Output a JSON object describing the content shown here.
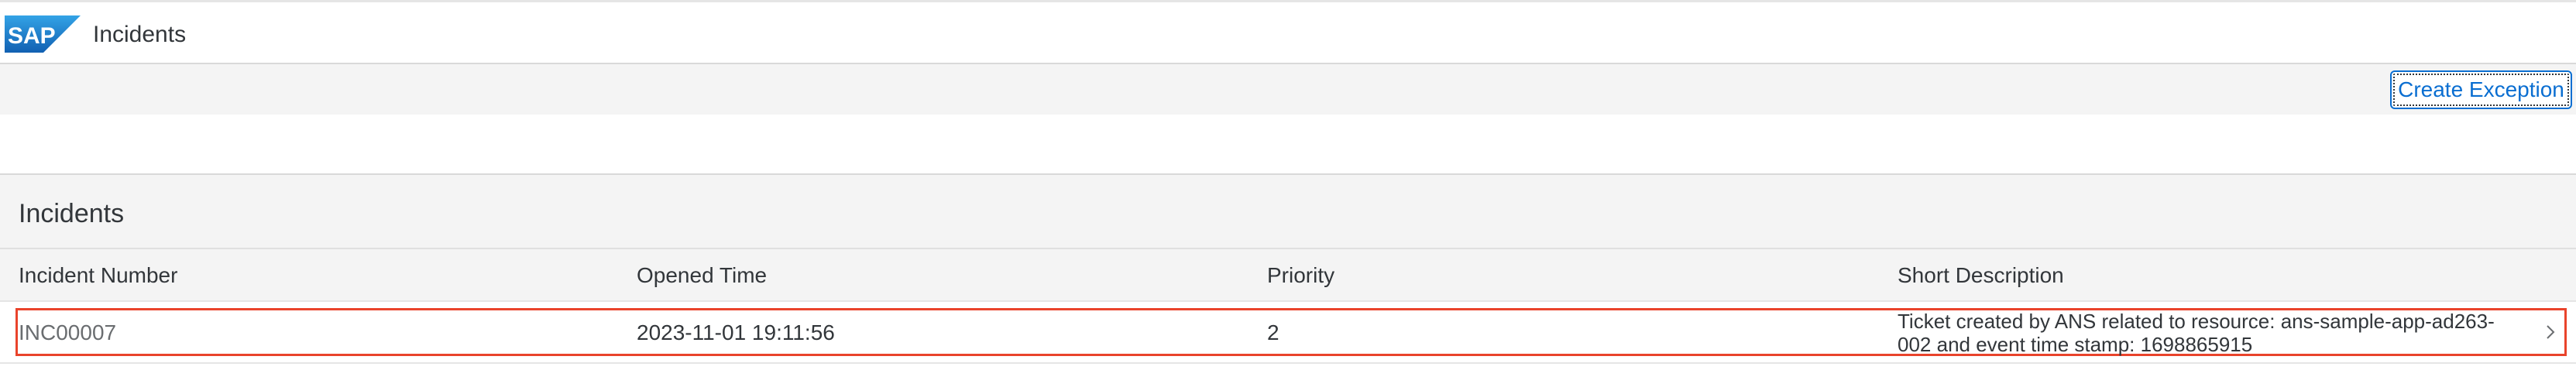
{
  "shell": {
    "logo_text": "SAP",
    "title": "Incidents",
    "brand_color": "#1a73c7"
  },
  "toolbar": {
    "create_exception_label": "Create Exception"
  },
  "table": {
    "title": "Incidents",
    "columns": [
      "Incident Number",
      "Opened Time",
      "Priority",
      "Short Description"
    ],
    "rows": [
      {
        "incident_number": "INC00007",
        "opened_time": "2023-11-01 19:11:56",
        "priority": "2",
        "short_description": "Ticket created by ANS related to resource: ans-sample-app-ad263-002 and event time stamp: 1698865915",
        "selected": true
      }
    ],
    "row_nav_icon": "chevron-right-icon",
    "highlight_color": "#e9432b"
  }
}
